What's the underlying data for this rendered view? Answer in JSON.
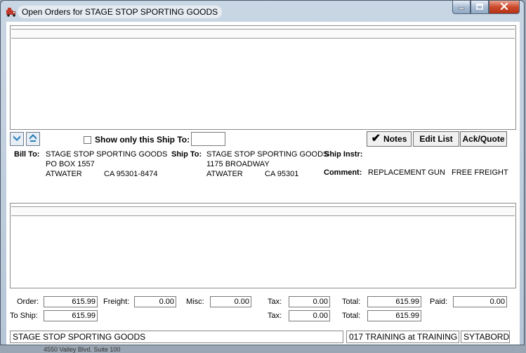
{
  "window": {
    "title": "Open Orders for STAGE STOP SPORTING GOODS"
  },
  "toolbar": {
    "show_only_label": "Show only this Ship To:",
    "show_only_value": "",
    "notes_label": "Notes",
    "edit_list_label": "Edit List",
    "ack_quote_label": "Ack/Quote"
  },
  "bill_to": {
    "label": "Bill To:",
    "name": "STAGE STOP SPORTING GOODS",
    "line1": "PO BOX 1557",
    "city": "ATWATER",
    "state_zip": "CA  95301-8474"
  },
  "ship_to": {
    "label": "Ship To:",
    "name": "STAGE STOP SPORTING GOODS",
    "line1": "1175 BROADWAY",
    "city": "ATWATER",
    "state_zip": "CA  95301"
  },
  "ship_instr": {
    "label": "Ship Instr:",
    "value": ""
  },
  "comment": {
    "label": "Comment:",
    "value1": "REPLACEMENT GUN",
    "value2": "FREE FREIGHT"
  },
  "totals": {
    "order_label": "Order:",
    "order": "615.99",
    "freight_label": "Freight:",
    "freight": "0.00",
    "misc_label": "Misc:",
    "misc": "0.00",
    "tax_label": "Tax:",
    "tax1": "0.00",
    "total_label": "Total:",
    "total1": "615.99",
    "paid_label": "Paid:",
    "paid": "0.00",
    "to_ship_label": "To Ship:",
    "to_ship": "615.99",
    "tax2": "0.00",
    "total2": "615.99"
  },
  "status_bar": {
    "customer": "STAGE STOP SPORTING GOODS",
    "location": "017 TRAINING at TRAINING",
    "user": "SYTABORD"
  },
  "background": {
    "partial_text": "4550 Valley Blvd. Suite 100"
  },
  "icons": [
    "truck-icon",
    "minimize-icon",
    "maximize-icon",
    "close-icon",
    "scroll-down-icon",
    "scroll-up-icon",
    "checkmark-icon"
  ]
}
